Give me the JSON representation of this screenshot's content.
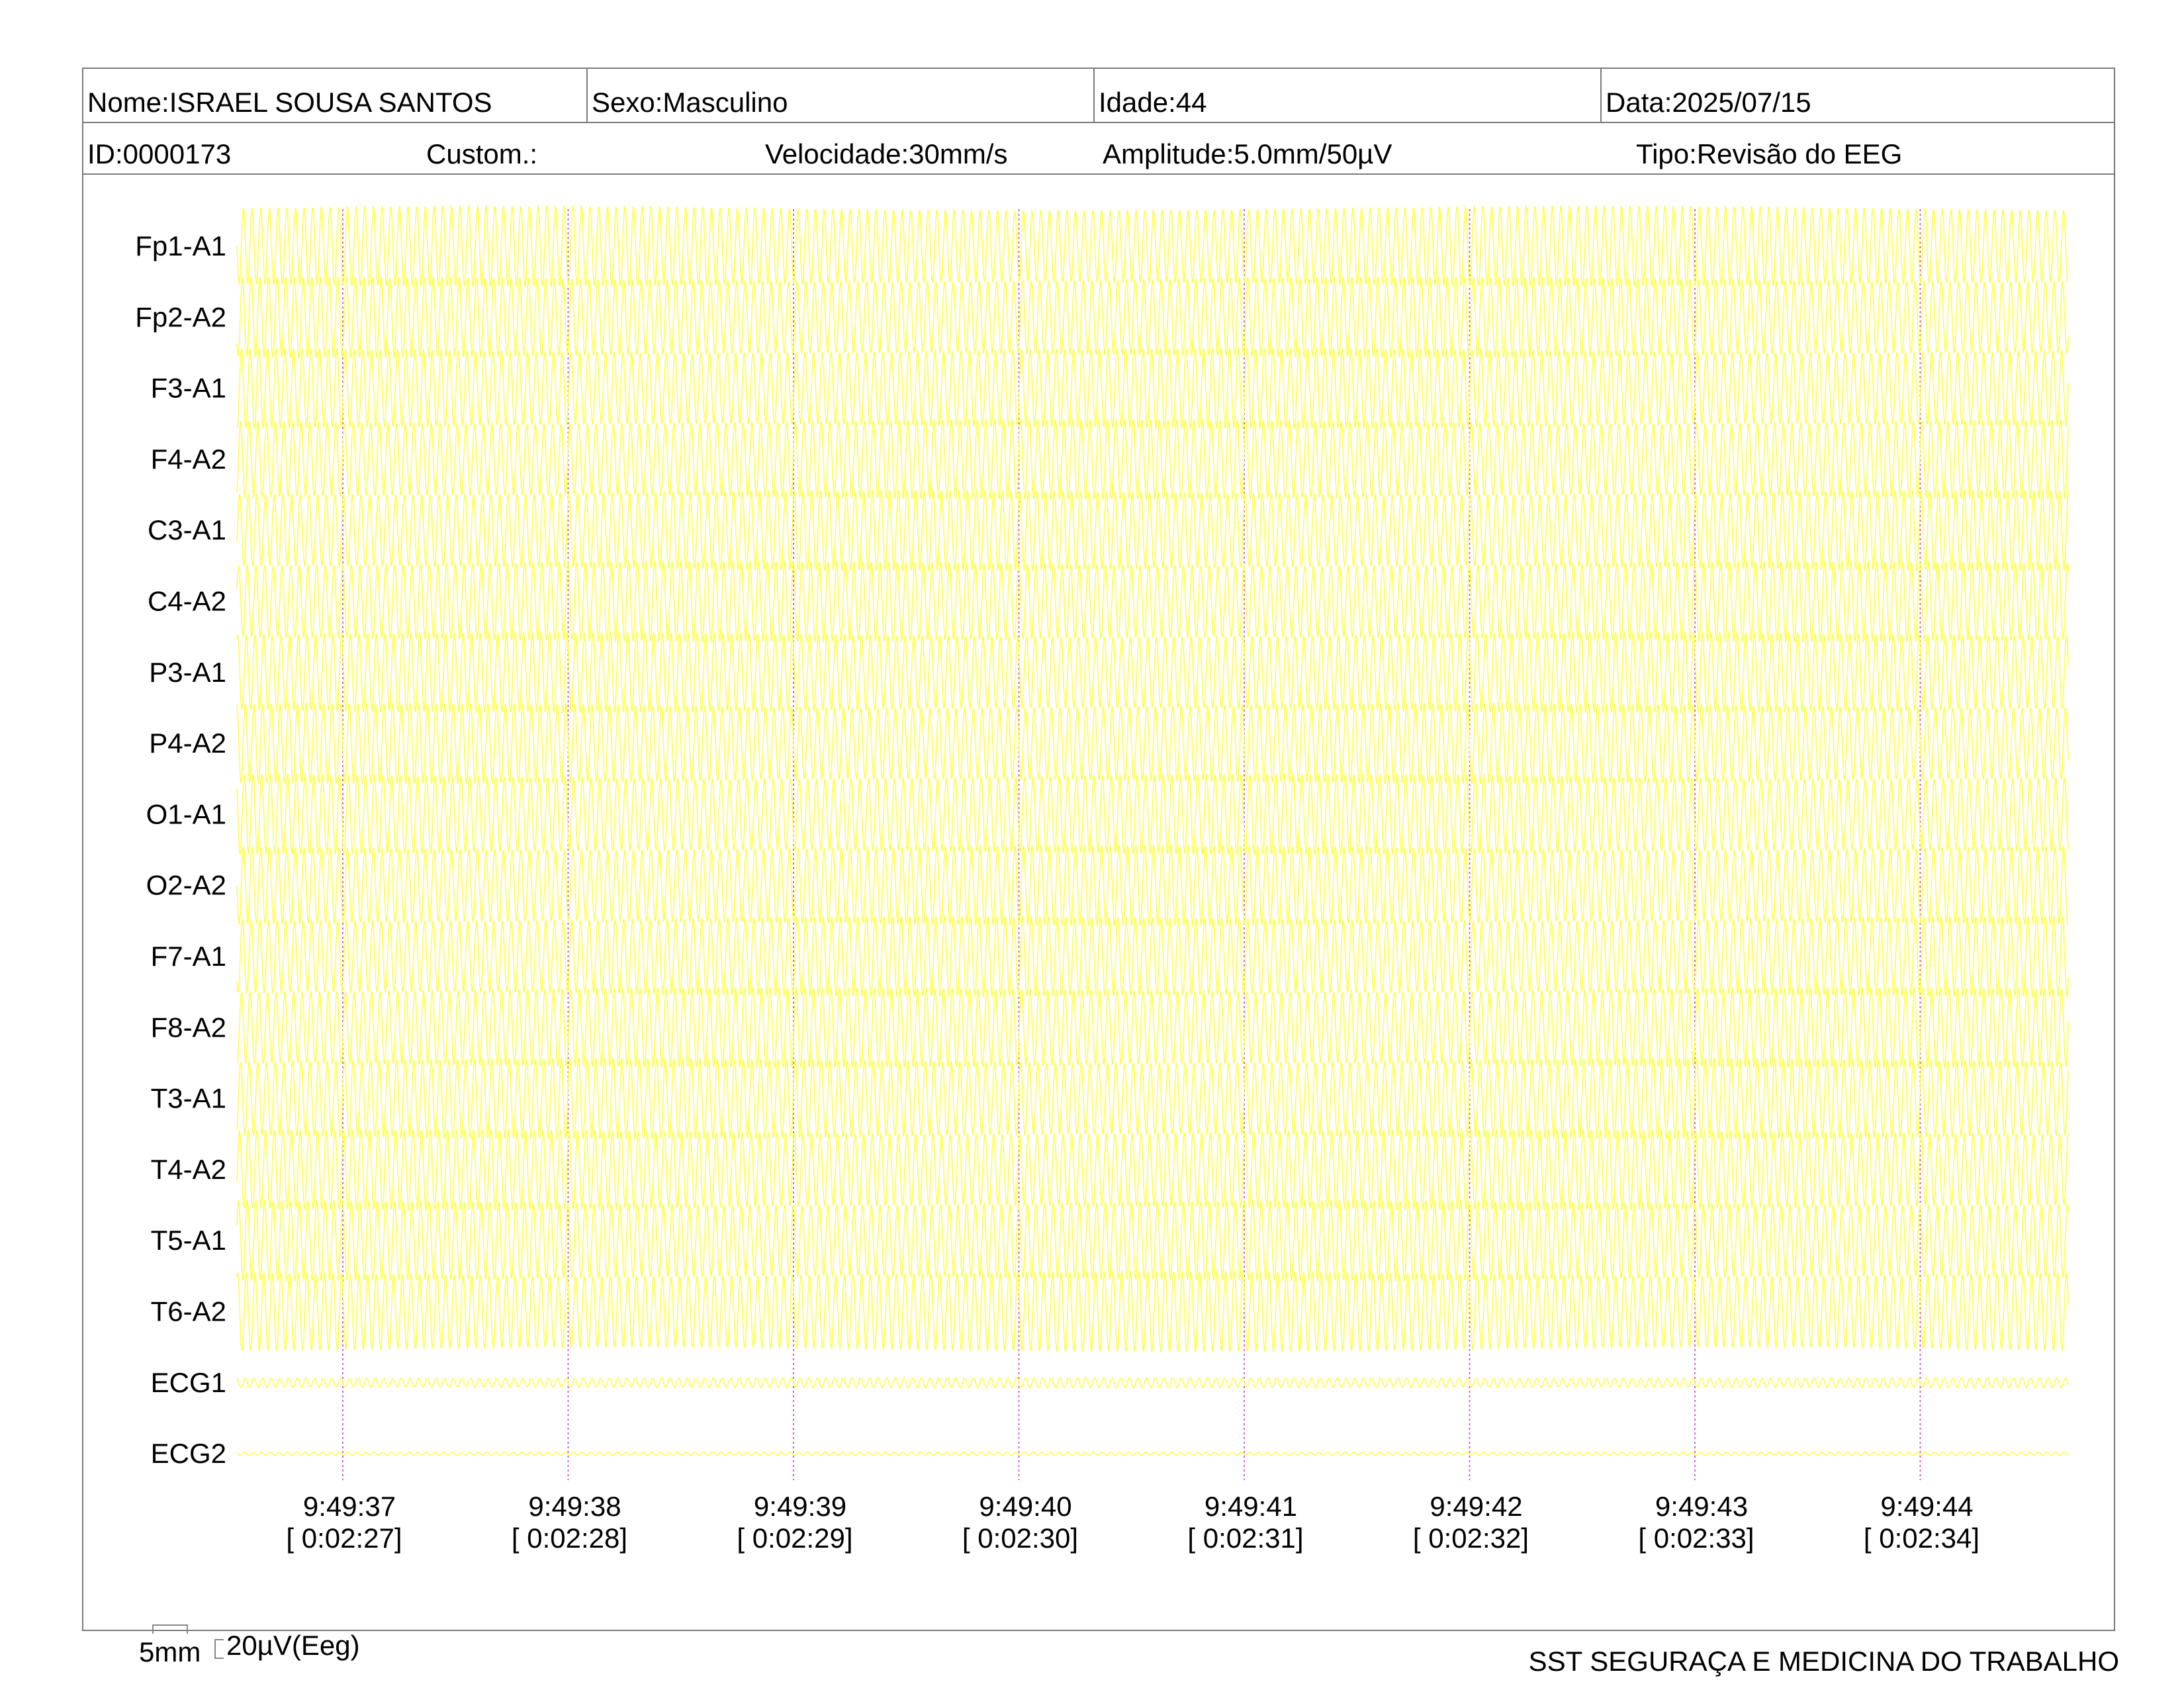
{
  "header": {
    "nome": "Nome:ISRAEL SOUSA SANTOS",
    "sexo": "Sexo:Masculino",
    "idade": "Idade:44",
    "data": "Data:2025/07/15",
    "id": "ID:0000173",
    "custom": "Custom.:",
    "velocidade": "Velocidade:30mm/s",
    "amplitude": "Amplitude:5.0mm/50µV",
    "tipo": "Tipo:Revisão do EEG"
  },
  "colors": {
    "trace": "#ffff44",
    "time_marker": "#d060d0",
    "frame": "#7a7a7a"
  },
  "chart_data": {
    "type": "line",
    "channels": [
      "Fp1-A1",
      "Fp2-A2",
      "F3-A1",
      "F4-A2",
      "C3-A1",
      "C4-A2",
      "P3-A1",
      "P4-A2",
      "O1-A1",
      "O2-A2",
      "F7-A1",
      "F8-A2",
      "T3-A1",
      "T4-A2",
      "T5-A1",
      "T6-A2",
      "ECG1",
      "ECG2"
    ],
    "x_ticks": [
      {
        "time": "9:49:37",
        "elapsed": "[ 0:02:27]"
      },
      {
        "time": "9:49:38",
        "elapsed": "[ 0:02:28]"
      },
      {
        "time": "9:49:39",
        "elapsed": "[ 0:02:29]"
      },
      {
        "time": "9:49:40",
        "elapsed": "[ 0:02:30]"
      },
      {
        "time": "9:49:41",
        "elapsed": "[ 0:02:31]"
      },
      {
        "time": "9:49:42",
        "elapsed": "[ 0:02:32]"
      },
      {
        "time": "9:49:43",
        "elapsed": "[ 0:02:33]"
      },
      {
        "time": "9:49:44",
        "elapsed": "[ 0:02:34]"
      }
    ],
    "eeg_relative_amplitude": 1.0,
    "ecg1_relative_amplitude": 0.12,
    "ecg2_relative_amplitude": 0.04,
    "oscillation_hz": 26
  },
  "footer": {
    "scale_time": "5mm",
    "scale_amp": "20µV(Eeg)",
    "company": "SST SEGURAÇA E MEDICINA DO TRABALHO"
  }
}
